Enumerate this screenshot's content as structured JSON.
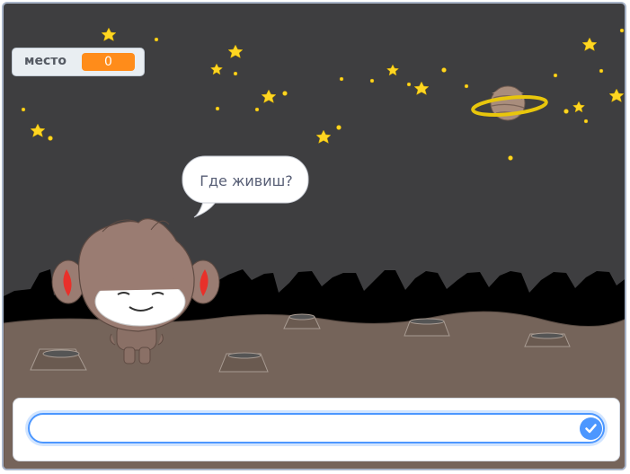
{
  "variable_monitor": {
    "label": "место",
    "value": "0"
  },
  "speech_bubble": {
    "text": "Где живиш?"
  },
  "ask_prompt": {
    "input_value": "",
    "submit_icon": "check-circle-icon"
  },
  "colors": {
    "sky": "#3e3e40",
    "ground": "#75645a",
    "mountains": "#000000",
    "monitor_value": "#ff8c1a",
    "accent": "#4c97ff",
    "star": "#ffd622"
  }
}
